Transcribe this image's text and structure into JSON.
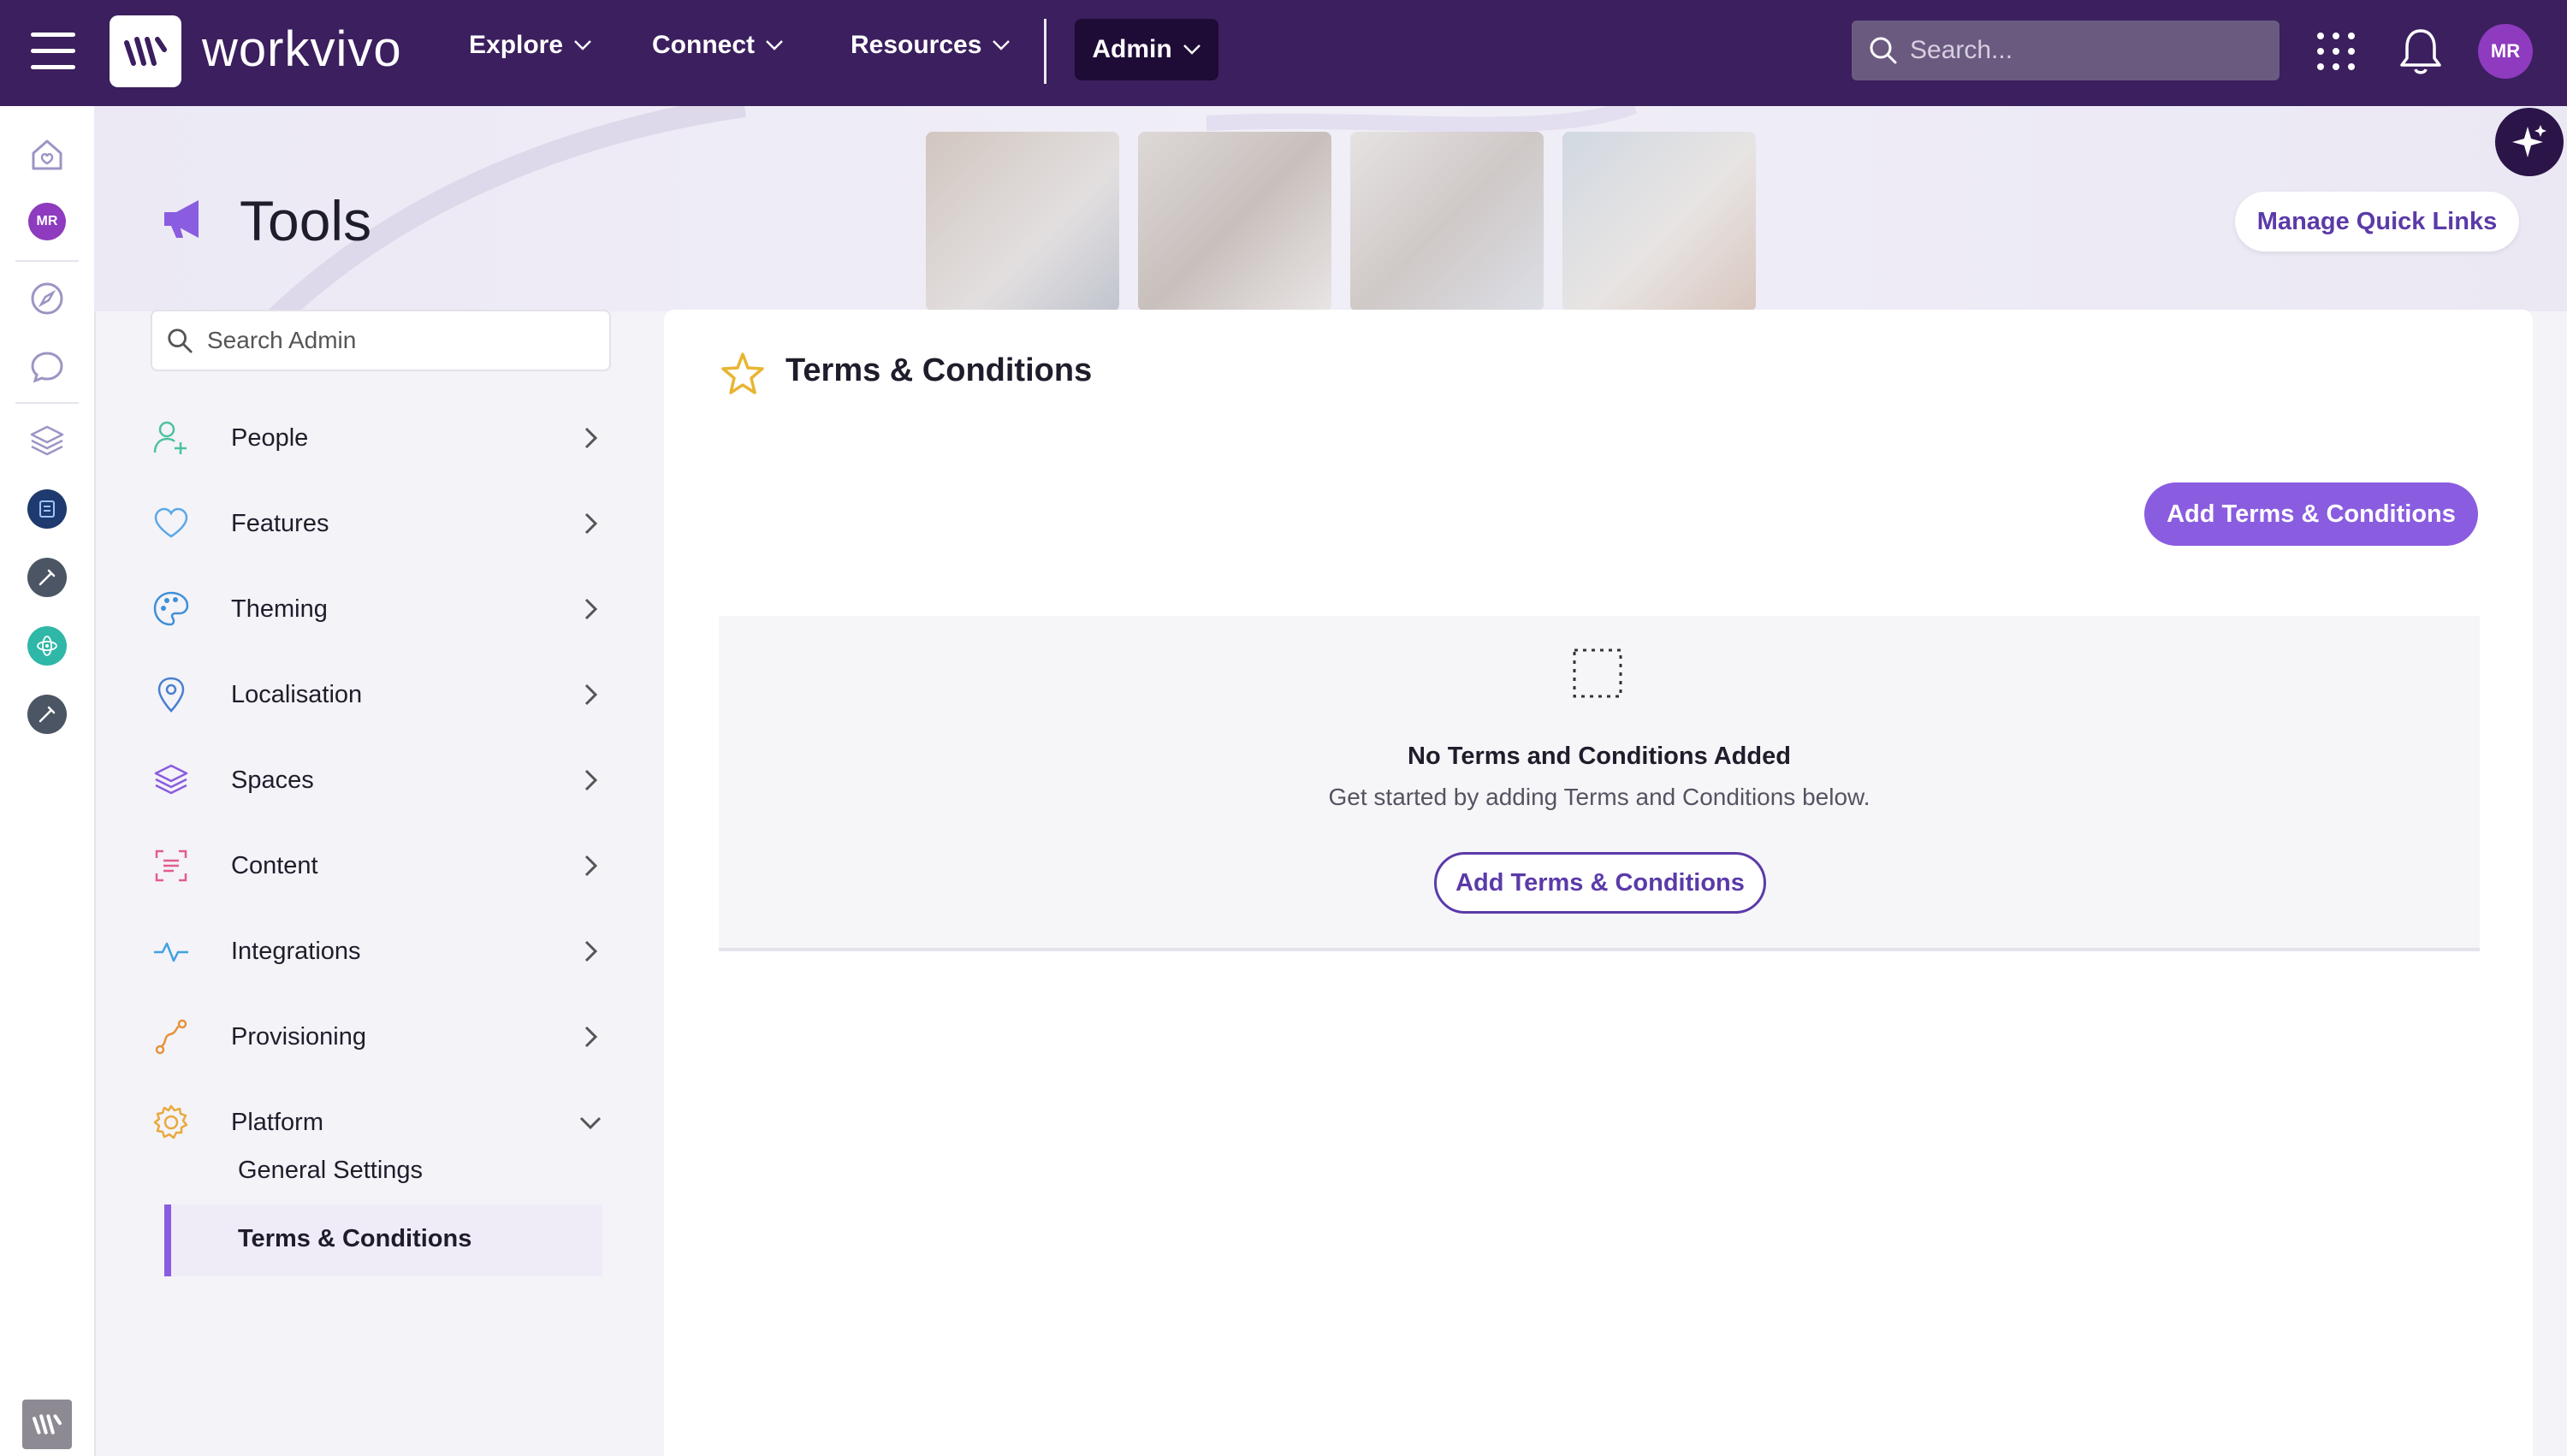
{
  "app": {
    "name": "workvivo"
  },
  "nav": {
    "items": [
      {
        "label": "Explore"
      },
      {
        "label": "Connect"
      },
      {
        "label": "Resources"
      }
    ],
    "admin_label": "Admin",
    "search_placeholder": "Search...",
    "user_initials": "MR"
  },
  "rail": {
    "user_initials": "MR",
    "icons": [
      "home-icon",
      "avatar",
      "compass-icon",
      "chat-icon",
      "layers-icon",
      "space-icon",
      "tool-icon",
      "atom-icon",
      "tool-icon"
    ]
  },
  "header": {
    "title": "Tools",
    "quick_links_label": "Manage Quick Links"
  },
  "sidebar": {
    "search_placeholder": "Search Admin",
    "items": [
      {
        "label": "People",
        "icon": "add-user-icon",
        "color": "#4cc1a0"
      },
      {
        "label": "Features",
        "icon": "heart-icon",
        "color": "#5aa8e6"
      },
      {
        "label": "Theming",
        "icon": "palette-icon",
        "color": "#3f8fd6"
      },
      {
        "label": "Localisation",
        "icon": "pin-icon",
        "color": "#4a7fd1"
      },
      {
        "label": "Spaces",
        "icon": "layers-icon",
        "color": "#8a5ce0"
      },
      {
        "label": "Content",
        "icon": "content-icon",
        "color": "#e25d8f"
      },
      {
        "label": "Integrations",
        "icon": "pulse-icon",
        "color": "#3fa1e0"
      },
      {
        "label": "Provisioning",
        "icon": "route-icon",
        "color": "#e7923b"
      },
      {
        "label": "Platform",
        "icon": "gear-icon",
        "color": "#e9a93c"
      }
    ],
    "sub_items": [
      {
        "label": "General Settings"
      },
      {
        "label": "Terms & Conditions"
      }
    ]
  },
  "main": {
    "title": "Terms & Conditions",
    "add_button_label": "Add Terms & Conditions",
    "empty": {
      "title": "No Terms and Conditions Added",
      "subtitle": "Get started by adding Terms and Conditions below.",
      "button_label": "Add Terms & Conditions"
    }
  },
  "colors": {
    "topbar": "#3b1f5e",
    "admin_button": "#1e0b36",
    "accent": "#8a5ce0",
    "accent_dark": "#5b3aa8",
    "star": "#e9b531"
  }
}
